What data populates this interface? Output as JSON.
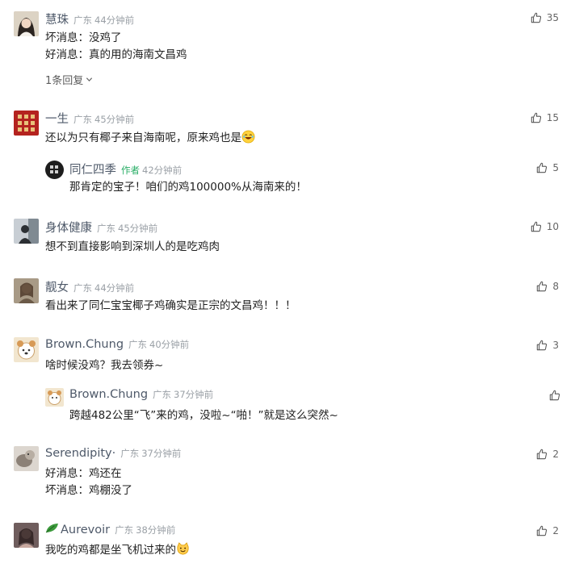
{
  "comments": [
    {
      "name": "慧珠",
      "location": "广东",
      "time": "44分钟前",
      "likes": "35",
      "lines": [
        "坏消息：没鸡了",
        "好消息：真的用的海南文昌鸡"
      ],
      "expand_label": "1条回复"
    },
    {
      "name": "一生",
      "location": "广东",
      "time": "45分钟前",
      "likes": "15",
      "lines": [
        "还以为只有椰子来自海南呢，原来鸡也是"
      ],
      "reply": {
        "name": "同仁四季",
        "badge": "作者",
        "time": "42分钟前",
        "likes": "5",
        "lines": [
          "那肯定的宝子！咱们的鸡100000%从海南来的！"
        ]
      }
    },
    {
      "name": "身体健康",
      "location": "广东",
      "time": "45分钟前",
      "likes": "10",
      "lines": [
        "想不到直接影响到深圳人的是吃鸡肉"
      ]
    },
    {
      "name": "靓女",
      "location": "广东",
      "time": "44分钟前",
      "likes": "8",
      "lines": [
        "看出来了同仁宝宝椰子鸡确实是正宗的文昌鸡！！！"
      ]
    },
    {
      "name": "Brown.Chung",
      "location": "广东",
      "time": "40分钟前",
      "likes": "3",
      "lines": [
        "啥时候没鸡？我去领券~"
      ],
      "reply": {
        "name": "Brown.Chung",
        "location": "广东",
        "time": "37分钟前",
        "likes": "",
        "lines": [
          "跨越482公里“飞”来的鸡，没啦~“啪！”就是这么突然~"
        ]
      }
    },
    {
      "name": "Serendipity·",
      "location": "广东",
      "time": "37分钟前",
      "likes": "2",
      "lines": [
        "好消息：鸡还在",
        "坏消息：鸡棚没了"
      ]
    },
    {
      "name": "Aurevoir",
      "location": "广东",
      "time": "38分钟前",
      "likes": "2",
      "lines": [
        "我吃的鸡都是坐飞机过来的"
      ]
    }
  ],
  "icons": {
    "like": "thumbs-up-icon",
    "expand": "chevron-down-icon",
    "emoji_laugh": "laugh-emoji",
    "emoji_cat": "cat-emoji",
    "name_prefix": "leaf-icon"
  },
  "colors": {
    "name": "#4e5969",
    "meta": "#9aa0a6",
    "author_badge": "#2aae67"
  }
}
